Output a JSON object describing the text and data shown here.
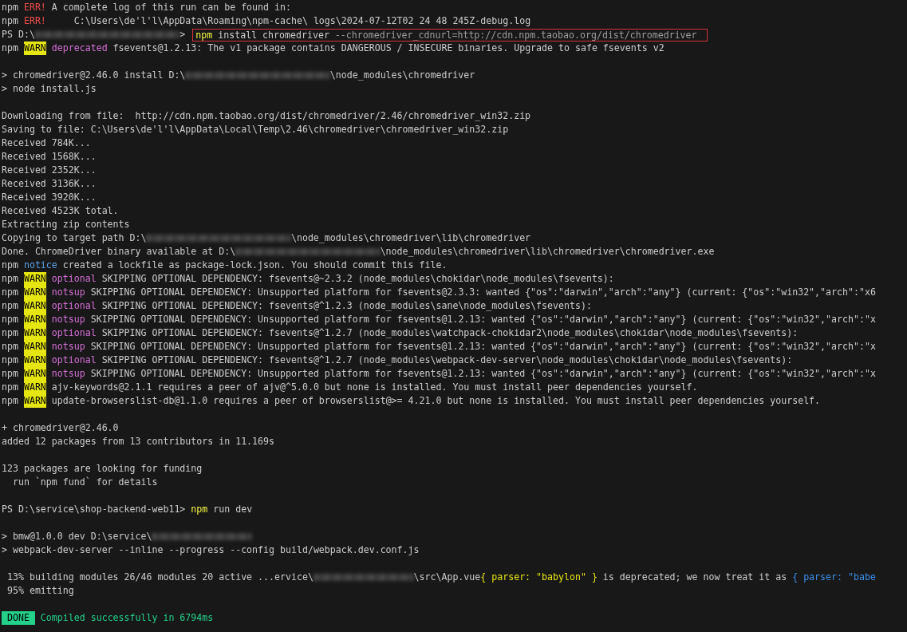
{
  "terminal": {
    "lines": [
      {
        "segments": [
          {
            "kind": "plain",
            "text": "npm "
          },
          {
            "kind": "err",
            "text": "ERR!"
          },
          {
            "kind": "plain",
            "text": " A complete log of this run can be found in:"
          }
        ]
      },
      {
        "segments": [
          {
            "kind": "plain",
            "text": "npm "
          },
          {
            "kind": "err",
            "text": "ERR!"
          },
          {
            "kind": "plain",
            "text": "     C:\\Users\\de'l'l\\AppData\\Roaming\\npm-cache\\ logs\\2024-07-12T02 24 48 245Z-debug.log"
          }
        ]
      },
      {
        "segments": [
          {
            "kind": "plain",
            "text": "PS D:\\"
          },
          {
            "kind": "redacted"
          },
          {
            "kind": "plain",
            "text": ">"
          },
          {
            "kind": "box",
            "segments": [
              {
                "kind": "cmd",
                "text": "npm"
              },
              {
                "kind": "plain",
                "text": " install chromedriver "
              },
              {
                "kind": "arg",
                "text": "--chromedriver_cdnurl=http://cdn.npm.taobao.org/dist/chromedriver"
              }
            ]
          }
        ]
      },
      {
        "segments": [
          {
            "kind": "plain",
            "text": "npm "
          },
          {
            "kind": "warn",
            "text": "WARN"
          },
          {
            "kind": "tag",
            "text": " deprecated"
          },
          {
            "kind": "plain",
            "text": " fsevents@1.2.13: The v1 package contains DANGEROUS / INSECURE binaries. Upgrade to safe fsevents v2"
          }
        ]
      },
      {
        "spaced": true,
        "segments": [
          {
            "kind": "plain",
            "text": "> chromedriver@2.46.0 install D:\\"
          },
          {
            "kind": "redacted"
          },
          {
            "kind": "plain",
            "text": "\\node_modules\\chromedriver"
          }
        ]
      },
      {
        "segments": [
          {
            "kind": "plain",
            "text": "> node install.js"
          }
        ]
      },
      {
        "spaced": true,
        "segments": [
          {
            "kind": "plain",
            "text": "Downloading from file:  http://cdn.npm.taobao.org/dist/chromedriver/2.46/chromedriver_win32.zip"
          }
        ]
      },
      {
        "segments": [
          {
            "kind": "plain",
            "text": "Saving to file: C:\\Users\\de'l'l\\AppData\\Local\\Temp\\2.46\\chromedriver\\chromedriver_win32.zip"
          }
        ]
      },
      {
        "segments": [
          {
            "kind": "plain",
            "text": "Received 784K..."
          }
        ]
      },
      {
        "segments": [
          {
            "kind": "plain",
            "text": "Received 1568K..."
          }
        ]
      },
      {
        "segments": [
          {
            "kind": "plain",
            "text": "Received 2352K..."
          }
        ]
      },
      {
        "segments": [
          {
            "kind": "plain",
            "text": "Received 3136K..."
          }
        ]
      },
      {
        "segments": [
          {
            "kind": "plain",
            "text": "Received 3920K..."
          }
        ]
      },
      {
        "segments": [
          {
            "kind": "plain",
            "text": "Received 4523K total."
          }
        ]
      },
      {
        "segments": [
          {
            "kind": "plain",
            "text": "Extracting zip contents"
          }
        ]
      },
      {
        "segments": [
          {
            "kind": "plain",
            "text": "Copying to target path D:\\"
          },
          {
            "kind": "redacted"
          },
          {
            "kind": "plain",
            "text": "\\node_modules\\chromedriver\\lib\\chromedriver"
          }
        ]
      },
      {
        "segments": [
          {
            "kind": "plain",
            "text": "Done. ChromeDriver binary available at D:\\"
          },
          {
            "kind": "redacted"
          },
          {
            "kind": "plain",
            "text": "\\node_modules\\chromedriver\\lib\\chromedriver\\chromedriver.exe"
          }
        ]
      },
      {
        "segments": [
          {
            "kind": "plain",
            "text": "npm "
          },
          {
            "kind": "notice",
            "text": "notice"
          },
          {
            "kind": "plain",
            "text": " created a lockfile as package-lock.json. You should commit this file."
          }
        ]
      },
      {
        "segments": [
          {
            "kind": "plain",
            "text": "npm "
          },
          {
            "kind": "warn",
            "text": "WARN"
          },
          {
            "kind": "tag",
            "text": " optional"
          },
          {
            "kind": "plain",
            "text": " SKIPPING OPTIONAL DEPENDENCY: fsevents@~2.3.2 (node_modules\\chokidar\\node_modules\\fsevents):"
          }
        ]
      },
      {
        "segments": [
          {
            "kind": "plain",
            "text": "npm "
          },
          {
            "kind": "warn",
            "text": "WARN"
          },
          {
            "kind": "tag",
            "text": " notsup"
          },
          {
            "kind": "plain",
            "text": " SKIPPING OPTIONAL DEPENDENCY: Unsupported platform for fsevents@2.3.3: wanted {\"os\":\"darwin\",\"arch\":\"any\"} (current: {\"os\":\"win32\",\"arch\":\"x6"
          }
        ]
      },
      {
        "segments": [
          {
            "kind": "plain",
            "text": "npm "
          },
          {
            "kind": "warn",
            "text": "WARN"
          },
          {
            "kind": "tag",
            "text": " optional"
          },
          {
            "kind": "plain",
            "text": " SKIPPING OPTIONAL DEPENDENCY: fsevents@^1.2.3 (node_modules\\sane\\node_modules\\fsevents):"
          }
        ]
      },
      {
        "segments": [
          {
            "kind": "plain",
            "text": "npm "
          },
          {
            "kind": "warn",
            "text": "WARN"
          },
          {
            "kind": "tag",
            "text": " notsup"
          },
          {
            "kind": "plain",
            "text": " SKIPPING OPTIONAL DEPENDENCY: Unsupported platform for fsevents@1.2.13: wanted {\"os\":\"darwin\",\"arch\":\"any\"} (current: {\"os\":\"win32\",\"arch\":\"x"
          }
        ]
      },
      {
        "segments": [
          {
            "kind": "plain",
            "text": "npm "
          },
          {
            "kind": "warn",
            "text": "WARN"
          },
          {
            "kind": "tag",
            "text": " optional"
          },
          {
            "kind": "plain",
            "text": " SKIPPING OPTIONAL DEPENDENCY: fsevents@^1.2.7 (node_modules\\watchpack-chokidar2\\node_modules\\chokidar\\node_modules\\fsevents):"
          }
        ]
      },
      {
        "segments": [
          {
            "kind": "plain",
            "text": "npm "
          },
          {
            "kind": "warn",
            "text": "WARN"
          },
          {
            "kind": "tag",
            "text": " notsup"
          },
          {
            "kind": "plain",
            "text": " SKIPPING OPTIONAL DEPENDENCY: Unsupported platform for fsevents@1.2.13: wanted {\"os\":\"darwin\",\"arch\":\"any\"} (current: {\"os\":\"win32\",\"arch\":\"x"
          }
        ]
      },
      {
        "segments": [
          {
            "kind": "plain",
            "text": "npm "
          },
          {
            "kind": "warn",
            "text": "WARN"
          },
          {
            "kind": "tag",
            "text": " optional"
          },
          {
            "kind": "plain",
            "text": " SKIPPING OPTIONAL DEPENDENCY: fsevents@^1.2.7 (node_modules\\webpack-dev-server\\node_modules\\chokidar\\node_modules\\fsevents):"
          }
        ]
      },
      {
        "segments": [
          {
            "kind": "plain",
            "text": "npm "
          },
          {
            "kind": "warn",
            "text": "WARN"
          },
          {
            "kind": "tag",
            "text": " notsup"
          },
          {
            "kind": "plain",
            "text": " SKIPPING OPTIONAL DEPENDENCY: Unsupported platform for fsevents@1.2.13: wanted {\"os\":\"darwin\",\"arch\":\"any\"} (current: {\"os\":\"win32\",\"arch\":\"x"
          }
        ]
      },
      {
        "segments": [
          {
            "kind": "plain",
            "text": "npm "
          },
          {
            "kind": "warn",
            "text": "WARN"
          },
          {
            "kind": "plain",
            "text": " ajv-keywords@2.1.1 requires a peer of ajv@^5.0.0 but none is installed. You must install peer dependencies yourself."
          }
        ]
      },
      {
        "segments": [
          {
            "kind": "plain",
            "text": "npm "
          },
          {
            "kind": "warn",
            "text": "WARN"
          },
          {
            "kind": "plain",
            "text": " update-browserslist-db@1.1.0 requires a peer of browserslist@>= 4.21.0 but none is installed. You must install peer dependencies yourself."
          }
        ]
      },
      {
        "spaced": true,
        "segments": [
          {
            "kind": "plain",
            "text": "+ chromedriver@2.46.0"
          }
        ]
      },
      {
        "segments": [
          {
            "kind": "plain",
            "text": "added 12 packages from 13 contributors in 11.169s"
          }
        ]
      },
      {
        "spaced": true,
        "segments": [
          {
            "kind": "plain",
            "text": "123 packages are looking for funding"
          }
        ]
      },
      {
        "segments": [
          {
            "kind": "plain",
            "text": "  run `npm fund` for details"
          }
        ]
      },
      {
        "spaced": true,
        "segments": [
          {
            "kind": "plain",
            "text": "PS D:\\service\\shop-backend-web11>"
          },
          {
            "kind": "cmd",
            "text": " npm"
          },
          {
            "kind": "plain",
            "text": " run dev"
          }
        ]
      },
      {
        "spaced": true,
        "segments": [
          {
            "kind": "plain",
            "text": "> bmw@1.0.0 dev D:\\service\\"
          },
          {
            "kind": "redacted_short"
          }
        ]
      },
      {
        "segments": [
          {
            "kind": "plain",
            "text": "> webpack-dev-server --inline --progress --config build/webpack.dev.conf.js"
          }
        ]
      },
      {
        "spaced": true,
        "segments": [
          {
            "kind": "plain",
            "text": " 13% building modules 26/46 modules 20 active ...ervice\\"
          },
          {
            "kind": "redacted_short"
          },
          {
            "kind": "plain",
            "text": "\\src\\App.vue"
          },
          {
            "kind": "brace",
            "text": "{ parser: \"babylon\" }"
          },
          {
            "kind": "plain",
            "text": " is deprecated; we now treat it as"
          },
          {
            "kind": "link",
            "text": " { parser: \"babe"
          }
        ]
      },
      {
        "segments": [
          {
            "kind": "plain",
            "text": " 95% emitting"
          }
        ]
      },
      {
        "spaced": true,
        "segments": [
          {
            "kind": "done",
            "text": " DONE "
          },
          {
            "kind": "success",
            "text": " Compiled successfully in 6794ms"
          }
        ]
      }
    ]
  }
}
